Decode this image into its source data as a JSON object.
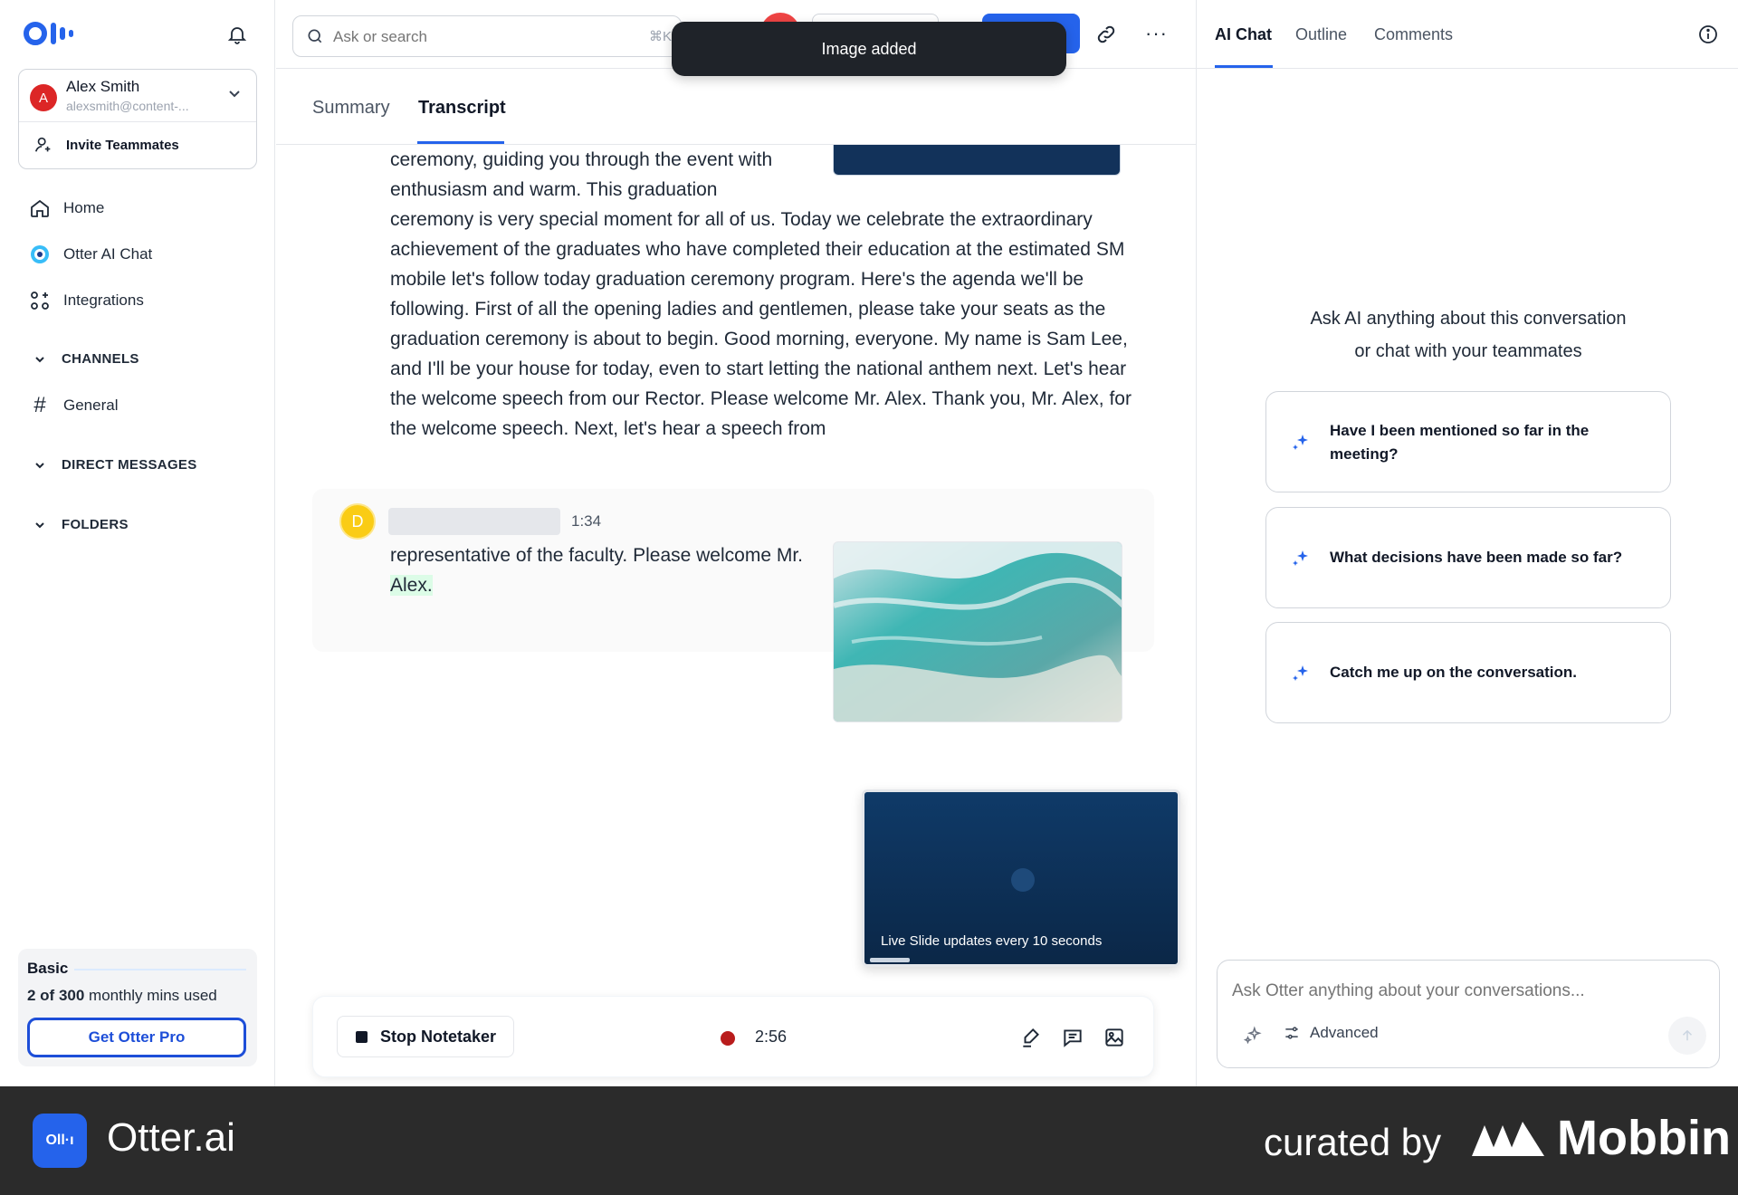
{
  "sidebar": {
    "account": {
      "avatar_letter": "A",
      "name": "Alex Smith",
      "email": "alexsmith@content-..."
    },
    "invite_label": "Invite Teammates",
    "nav": [
      {
        "label": "Home",
        "icon": "home-icon"
      },
      {
        "label": "Otter AI Chat",
        "icon": "otter-ai-chat-icon"
      },
      {
        "label": "Integrations",
        "icon": "integrations-icon"
      }
    ],
    "sections": {
      "channels": "CHANNELS",
      "direct_messages": "DIRECT MESSAGES",
      "folders": "FOLDERS"
    },
    "channels": [
      {
        "label": "General",
        "icon": "hash-icon"
      }
    ],
    "plan": {
      "name": "Basic",
      "usage_prefix": "2 of 300",
      "usage_suffix": " monthly mins used",
      "cta": "Get Otter Pro"
    }
  },
  "topbar": {
    "search_placeholder": "Ask or search",
    "search_shortcut": "⌘K",
    "more": "···"
  },
  "toast": "Image added",
  "tabs": [
    {
      "label": "Summary",
      "active": false
    },
    {
      "label": "Transcript",
      "active": true
    }
  ],
  "transcript": {
    "block1_narrow": "ceremony, guiding you through the event with enthusiasm and warm. This graduation",
    "block1_rest": "ceremony is very special moment for all of us. Today we celebrate the extraordinary achievement of the graduates who have completed their education at the estimated SM mobile let's follow today graduation ceremony program. Here's the agenda we'll be following. First of all the opening ladies and gentlemen, please take your seats as the graduation ceremony is about to begin. Good morning, everyone. My name is Sam Lee, and I'll be your house for today, even to start letting the national anthem next. Let's hear the welcome speech from our Rector. Please welcome Mr. Alex. Thank you, Mr. Alex, for the welcome speech. Next, let's hear a speech from",
    "speaker": {
      "avatar_letter": "D",
      "time": "1:34",
      "text_before": "representative of the faculty. Please welcome Mr.",
      "text_highlight": " Alex."
    }
  },
  "live_slide": {
    "label": "Live Slide updates every 10 seconds"
  },
  "recording": {
    "stop_label": "Stop Notetaker",
    "elapsed": "2:56"
  },
  "right_panel": {
    "tabs": [
      {
        "label": "AI Chat",
        "active": true
      },
      {
        "label": "Outline",
        "active": false
      },
      {
        "label": "Comments",
        "active": false
      }
    ],
    "prompt_line1": "Ask AI anything about this conversation",
    "prompt_line2": "or chat with your teammates",
    "suggestions": [
      "Have I been mentioned so far in the meeting?",
      "What decisions have been made so far?",
      "Catch me up on the conversation."
    ],
    "chat_placeholder": "Ask Otter anything about your conversations...",
    "advanced_label": "Advanced"
  },
  "footer": {
    "app_name": "Otter.ai",
    "curated_by": "curated by",
    "brand": "Mobbin",
    "app_logo_text": "Oll·ı"
  },
  "colors": {
    "accent": "#2563eb",
    "toast_bg": "#1f2329",
    "record": "#b91c1c",
    "highlight": "#dcfce7"
  }
}
